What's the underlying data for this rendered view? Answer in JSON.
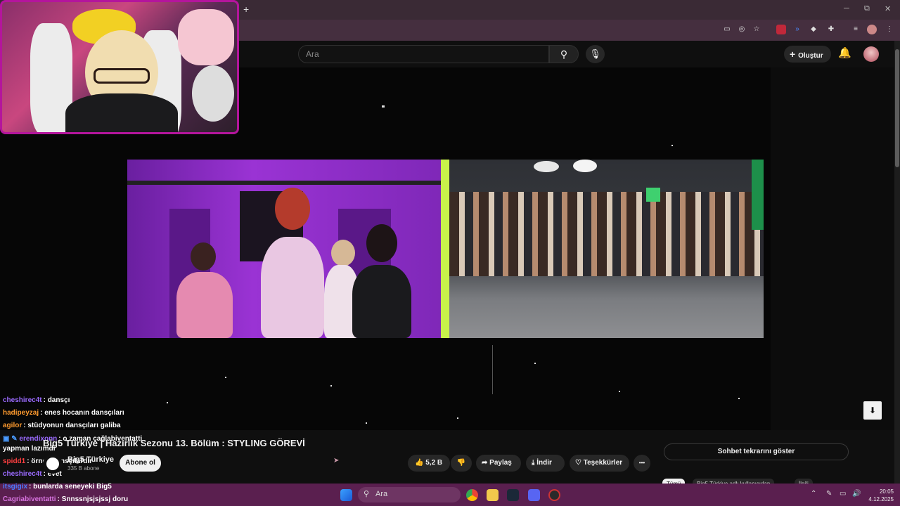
{
  "browser": {
    "new_tab_label": "+",
    "window_controls": [
      "─",
      "⧉",
      "✕"
    ]
  },
  "youtube": {
    "search": {
      "placeholder": "Ara"
    },
    "create_label": "Oluştur"
  },
  "video": {
    "title": "Big5 Türkiye | Hazırlık Sezonu 13. Bölüm : STYLING GÖREVİ",
    "channel": "Big5 Türkiye",
    "subscribers": "335 B abone",
    "subscribe_label": "Abone ol",
    "likes": "5,2 B",
    "share_label": "Paylaş",
    "download_label": "İndir",
    "thanks_label": "Teşekkürler",
    "more_label": "•••"
  },
  "sidebar": {
    "chat_replay_label": "Sohbet tekrarını göster",
    "chips": [
      "Tümü",
      "Big5 Türkiye adlı kullanıcıdan",
      "İlgili"
    ]
  },
  "chat": [
    {
      "user": "cheshirec4t",
      "message": "dansçı",
      "color": "#9b6bff"
    },
    {
      "user": "hadipeyzaj",
      "message": "enes hocanın dansçıları",
      "color": "#ff9b2f"
    },
    {
      "user": "agilor",
      "message": "stüdyonun dansçıları galiba",
      "color": "#ff9b2f"
    },
    {
      "user": "erendixonn",
      "message": "o zaman çağlabiventatti yapman lazımdı",
      "color": "#9b6bff"
    },
    {
      "user": "spidd1",
      "message": "örnek dansçılardır",
      "color": "#ff4040"
    },
    {
      "user": "cheshirec4t",
      "message": "evet",
      "color": "#9b6bff"
    },
    {
      "user": "itsgigix",
      "message": "bunlarda seneyeki Big5",
      "color": "#4a7bff"
    },
    {
      "user": "Cagriabiventatti",
      "message": "Snnssnjsjsjssj doru",
      "color": "#d874e0"
    }
  ],
  "taskbar": {
    "search_placeholder": "Ara",
    "time": "20:05",
    "date": "4.12.2025"
  },
  "colors": {
    "accent_webcam_border": "#b4159c",
    "taskbar": "#5a1f4f",
    "player_bg": "#060606"
  }
}
